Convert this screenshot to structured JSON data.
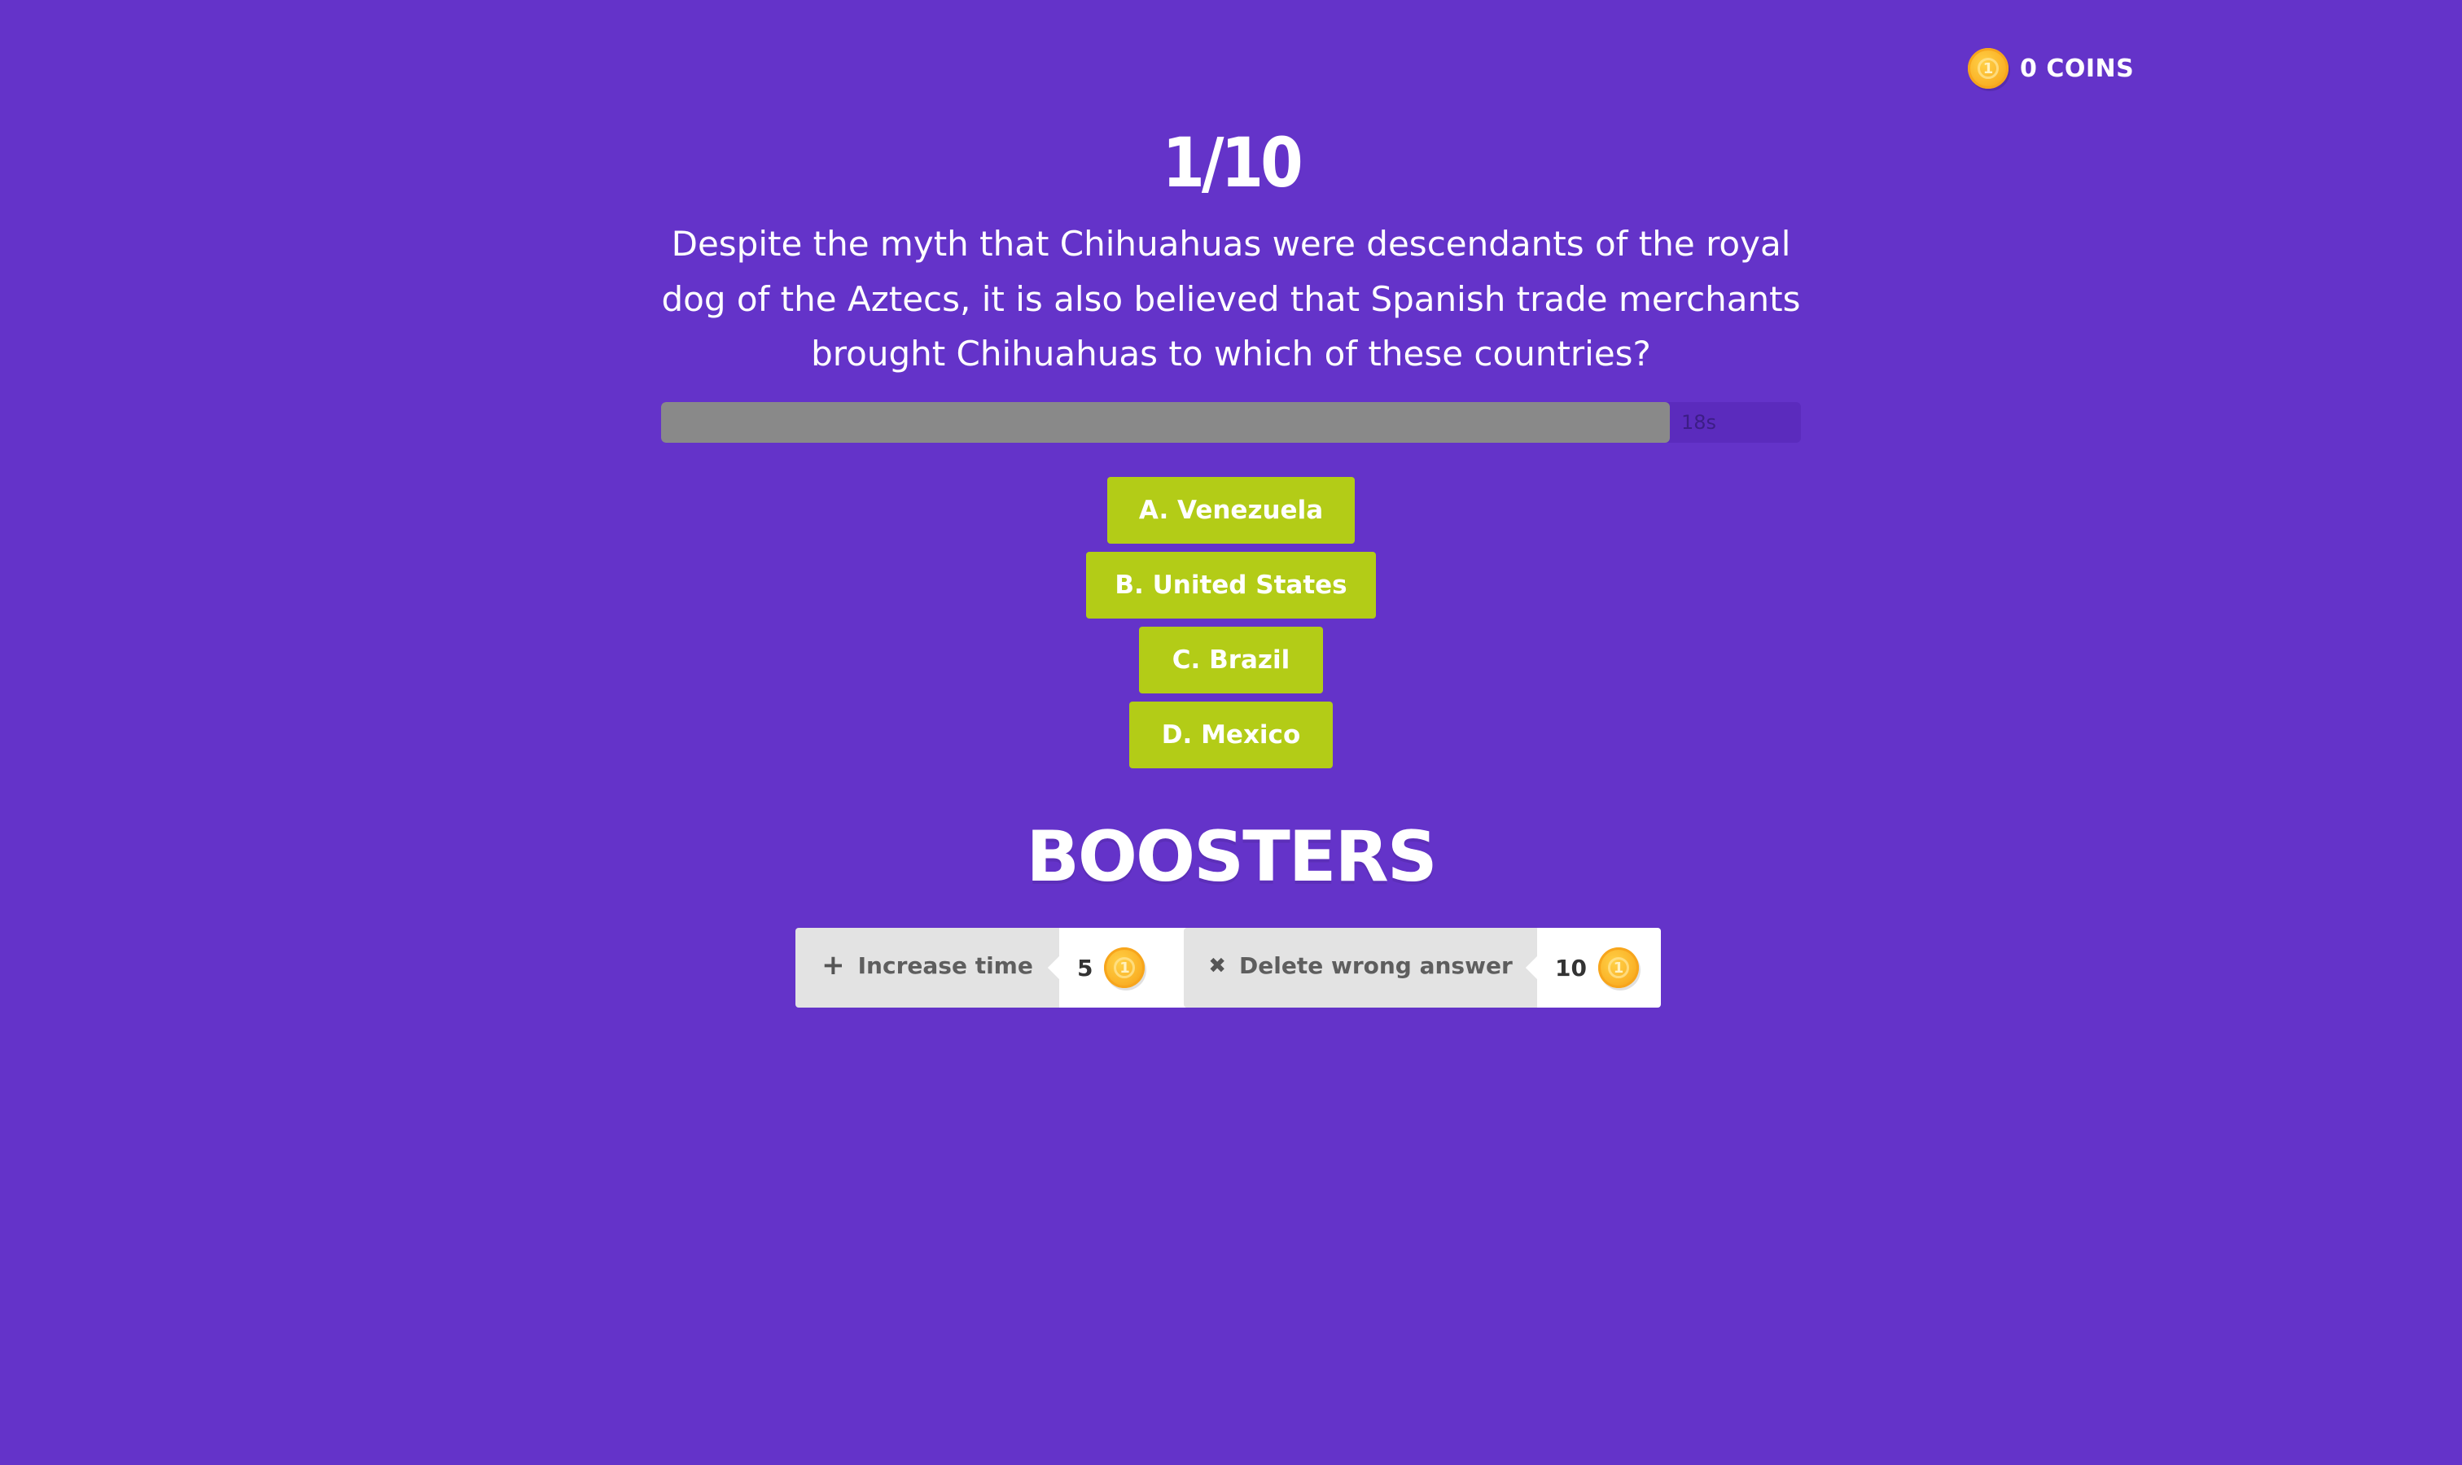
{
  "wallet": {
    "coin_icon": "coin-icon",
    "coins_text": "0 COINS",
    "coin_glyph": "1"
  },
  "quiz": {
    "counter": "1/10",
    "question": "Despite the myth that Chihuahuas were descendants of the royal dog of the Aztecs, it is also believed that Spanish trade merchants brought Chihuahuas to which of these countries?",
    "timer": {
      "label": "18s",
      "remaining_fraction": 0.885
    },
    "answers": [
      {
        "label": "A. Venezuela"
      },
      {
        "label": "B. United States"
      },
      {
        "label": "C. Brazil"
      },
      {
        "label": "D. Mexico"
      }
    ]
  },
  "boosters": {
    "title": "BOOSTERS",
    "items": [
      {
        "icon": "plus-icon",
        "icon_glyph": "+",
        "label": "Increase time",
        "cost": "5"
      },
      {
        "icon": "close-icon",
        "icon_glyph": "✖",
        "label": "Delete wrong answer",
        "cost": "10"
      }
    ]
  },
  "colors": {
    "background": "#6433c9",
    "answer_button": "#b3cc17",
    "timer_fill": "#898989",
    "coin": "#fbb52a"
  }
}
